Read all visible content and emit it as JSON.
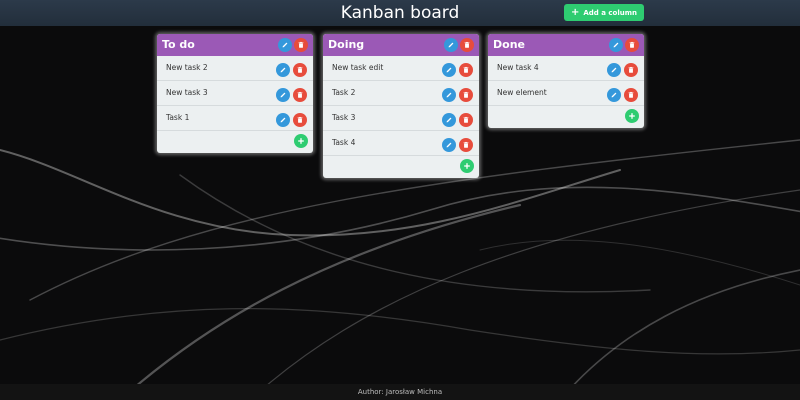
{
  "header": {
    "title": "Kanban board",
    "add_column_label": "Add a column"
  },
  "columns": [
    {
      "title": "To do",
      "cards": [
        "New task 2",
        "New task 3",
        "Task 1"
      ]
    },
    {
      "title": "Doing",
      "cards": [
        "New task edit",
        "Task 2",
        "Task 3",
        "Task 4"
      ]
    },
    {
      "title": "Done",
      "cards": [
        "New task 4",
        "New element"
      ]
    }
  ],
  "icons": {
    "edit": "pencil-icon",
    "delete": "trash-icon",
    "add": "plus-icon"
  },
  "footer": {
    "author": "Author: Jarosław Michna"
  },
  "colors": {
    "header_bg": "#2c3a4a",
    "column_header": "#9b59b6",
    "column_body": "#ecf0f1",
    "edit": "#3498db",
    "delete": "#e74c3c",
    "add": "#2ecc71"
  }
}
